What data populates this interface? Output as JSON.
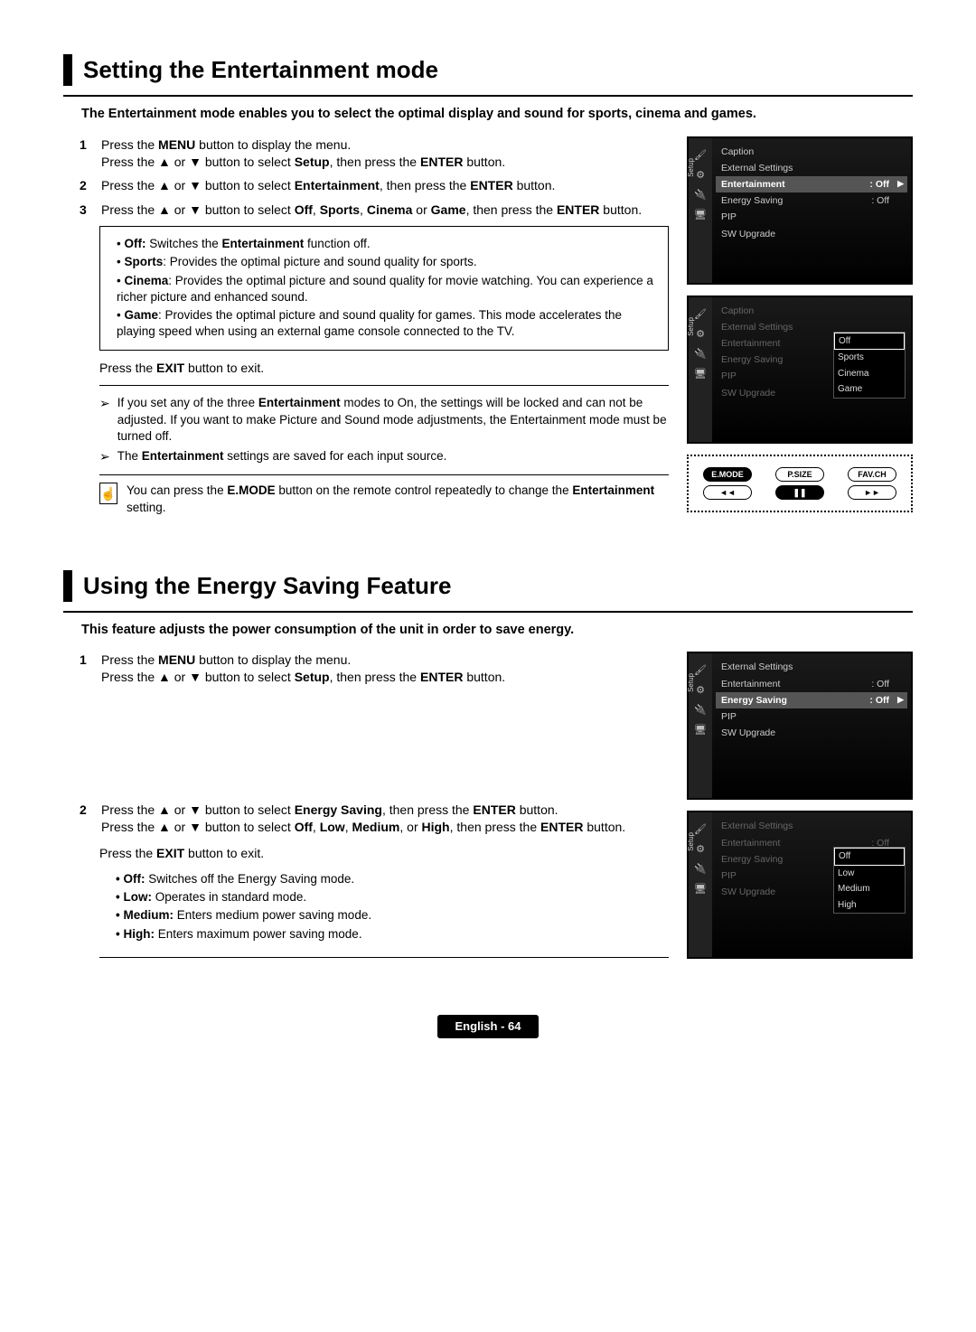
{
  "section1": {
    "title": "Setting the Entertainment mode",
    "intro": "The Entertainment mode enables you to select the optimal display and sound for sports, cinema and games.",
    "step1_num": "1",
    "step1_line1a": "Press the ",
    "step1_line1b": "MENU",
    "step1_line1c": " button to display the menu.",
    "step1_line2a": "Press the ▲ or ▼ button to select ",
    "step1_line2b": "Setup",
    "step1_line2c": ", then press the ",
    "step1_line2d": "ENTER",
    "step1_line2e": " button.",
    "step2_num": "2",
    "step2_a": "Press the ▲ or ▼ button to select ",
    "step2_b": "Entertainment",
    "step2_c": ", then press the ",
    "step2_d": "ENTER",
    "step2_e": " button.",
    "step3_num": "3",
    "step3_a": "Press the ▲ or ▼ button to select ",
    "step3_b": "Off",
    "step3_c": ", ",
    "step3_d": "Sports",
    "step3_e": ", ",
    "step3_f": "Cinema",
    "step3_g": " or ",
    "step3_h": "Game",
    "step3_i": ", then press the ",
    "step3_j": "ENTER",
    "step3_k": " button.",
    "box": {
      "off_b": "Off:",
      "off_t": " Switches the ",
      "off_b2": "Entertainment",
      "off_t2": " function off.",
      "sports_b": "Sports",
      "sports_t": ": Provides the optimal picture and sound quality for sports.",
      "cinema_b": "Cinema",
      "cinema_t": ": Provides the optimal picture and sound quality for movie watching. You can experience a richer picture and enhanced sound.",
      "game_b": "Game",
      "game_t": ": Provides the optimal picture and sound quality for games. This mode accelerates the playing speed when using an external game console connected to the TV."
    },
    "exit_a": "Press the ",
    "exit_b": "EXIT",
    "exit_c": " button to exit.",
    "arrow1_a": "If you set any of the three ",
    "arrow1_b": "Entertainment",
    "arrow1_c": " modes to On, the settings will be locked and can not be adjusted. If you want to make Picture and Sound mode adjustments, the Entertainment mode must be turned off.",
    "arrow2_a": "The ",
    "arrow2_b": "Entertainment",
    "arrow2_c": " settings are saved for each input source.",
    "tip_a": "You can press the ",
    "tip_b": "E.MODE",
    "tip_c": " button on the remote control repeatedly to change the ",
    "tip_d": "Entertainment",
    "tip_e": " setting.",
    "osd1": {
      "setup": "Setup",
      "caption": "Caption",
      "ext": "External Settings",
      "ent": "Entertainment",
      "ent_val": ": Off",
      "es": "Energy Saving",
      "es_val": ": Off",
      "pip": "PIP",
      "sw": "SW Upgrade"
    },
    "osd2": {
      "dd_off": "Off",
      "dd_sports": "Sports",
      "dd_cinema": "Cinema",
      "dd_game": "Game"
    },
    "remote": {
      "emode": "E.MODE",
      "psize": "P.SIZE",
      "favch": "FAV.CH",
      "rew": "◄◄",
      "pause": "❚❚",
      "ff": "►►"
    }
  },
  "section2": {
    "title": "Using the Energy Saving Feature",
    "intro": "This feature adjusts the power consumption of the unit in order to save energy.",
    "step1_num": "1",
    "step1": {
      "l1a": "Press the ",
      "l1b": "MENU",
      "l1c": " button to display the menu.",
      "l2a": "Press the ▲ or ▼ button to select ",
      "l2b": "Setup",
      "l2c": ", then press the ",
      "l2d": "ENTER",
      "l2e": " button."
    },
    "step2_num": "2",
    "step2": {
      "l1a": "Press the ▲ or ▼ button to select ",
      "l1b": "Energy Saving",
      "l1c": ", then press the ",
      "l1d": "ENTER",
      "l1e": " button.",
      "l2a": "Press the ▲ or ▼ button to select ",
      "l2b": "Off",
      "l2c": ", ",
      "l2d": "Low",
      "l2e": ", ",
      "l2f": "Medium",
      "l2g": ", or ",
      "l2h": "High",
      "l2i": ", then press the ",
      "l2j": "ENTER",
      "l2k": " button.",
      "exit_a": "Press the ",
      "exit_b": "EXIT",
      "exit_c": " button to exit."
    },
    "box": {
      "off_b": "Off:",
      "off_t": " Switches off the Energy Saving mode.",
      "low_b": "Low:",
      "low_t": " Operates in standard mode.",
      "med_b": "Medium:",
      "med_t": " Enters medium power saving mode.",
      "high_b": "High:",
      "high_t": " Enters maximum power saving mode."
    },
    "osd3": {
      "setup": "Setup",
      "ext": "External Settings",
      "ent": "Entertainment",
      "ent_val": ": Off",
      "es": "Energy Saving",
      "es_val": ": Off",
      "pip": "PIP",
      "sw": "SW Upgrade"
    },
    "osd4": {
      "dd_off": "Off",
      "dd_low": "Low",
      "dd_med": "Medium",
      "dd_high": "High"
    }
  },
  "footer": "English - 64"
}
